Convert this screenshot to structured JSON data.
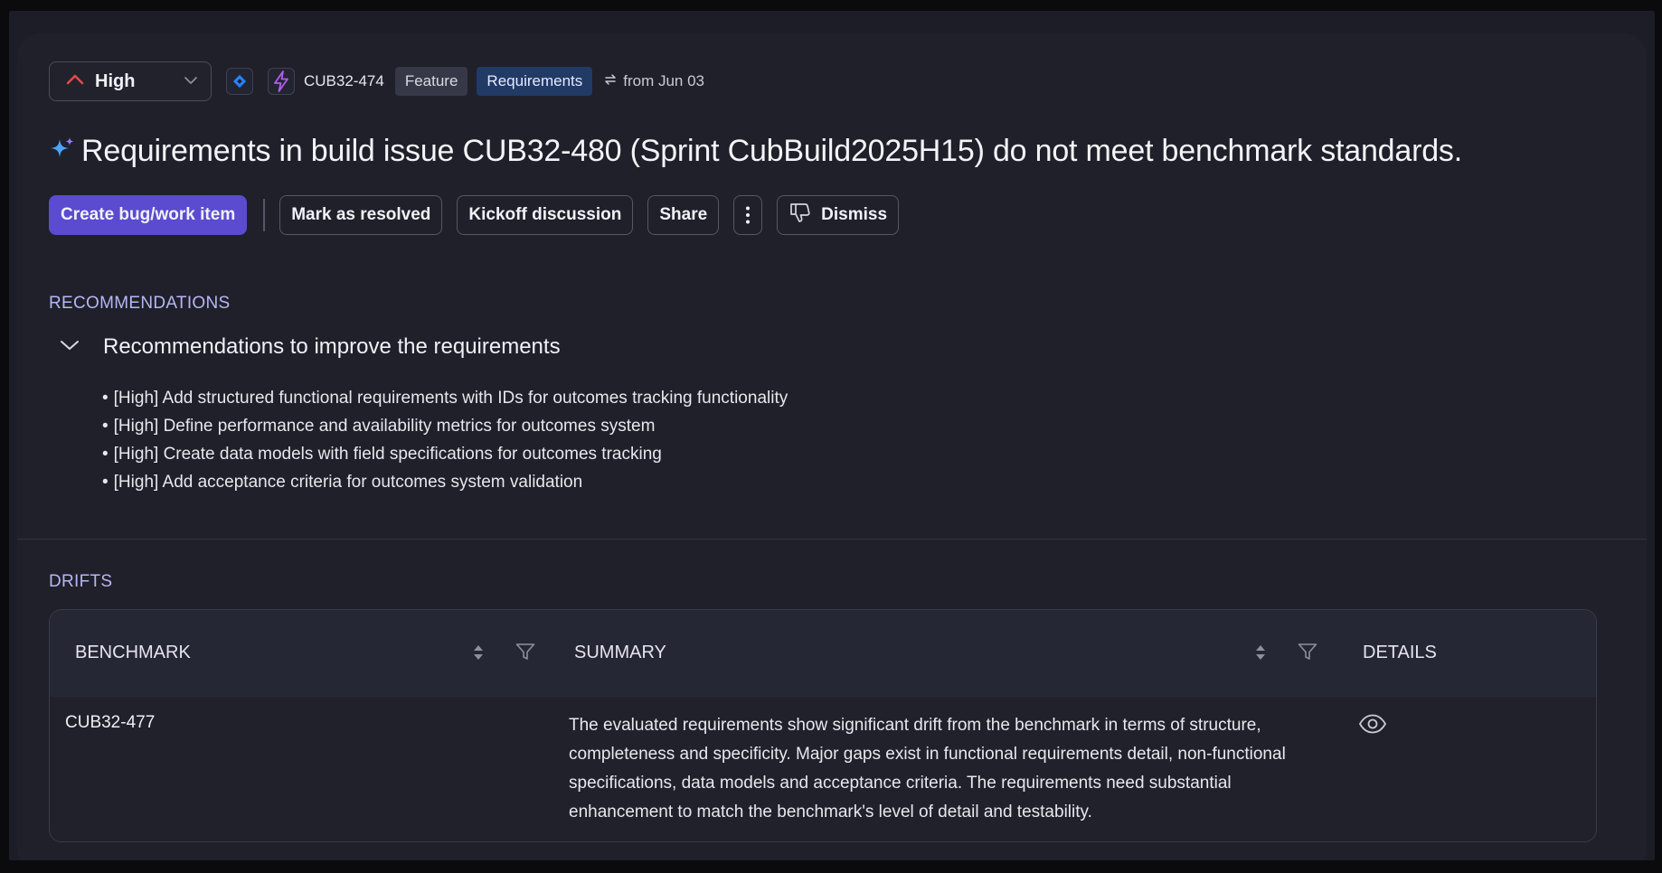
{
  "header": {
    "priority": {
      "label": "High",
      "icon": "priority-high-arrow-icon"
    },
    "tracker_icon": "jira-diamond-icon",
    "issue": {
      "icon": "lightning-bolt-icon",
      "key": "CUB32-474"
    },
    "tags": [
      "Feature",
      "Requirements"
    ],
    "from": {
      "icon": "sync-arrows-icon",
      "text": "from Jun 03"
    }
  },
  "title": {
    "icon": "sparkle-icon",
    "text": "Requirements in build issue CUB32-480 (Sprint CubBuild2025H15) do not meet benchmark standards."
  },
  "actions": {
    "create": "Create bug/work item",
    "resolve": "Mark as resolved",
    "kickoff": "Kickoff discussion",
    "share": "Share",
    "more_icon": "more-vertical-icon",
    "dismiss": "Dismiss",
    "dismiss_icon": "thumbs-down-icon"
  },
  "recommendations": {
    "section_label": "RECOMMENDATIONS",
    "group_title": "Recommendations to improve the requirements",
    "items": [
      "[High] Add structured functional requirements with IDs for outcomes tracking functionality",
      "[High] Define performance and availability metrics for outcomes system",
      "[High] Create data models with field specifications for outcomes tracking",
      "[High] Add acceptance criteria for outcomes system validation"
    ]
  },
  "drifts": {
    "section_label": "DRIFTS",
    "columns": [
      "BENCHMARK",
      "SUMMARY",
      "DETAILS"
    ],
    "rows": [
      {
        "benchmark": "CUB32-477",
        "summary": "The evaluated requirements show significant drift from the benchmark in terms of structure, completeness and specificity. Major gaps exist in functional requirements detail, non-functional specifications, data models and acceptance criteria. The requirements need substantial enhancement to match the benchmark's level of detail and testability.",
        "details_icon": "eye-icon"
      }
    ]
  },
  "colors": {
    "primary": "#5b4bd0",
    "priority_high": "#e5484d",
    "section_label": "#b7b6f6",
    "tag_requirements_bg": "#213a66"
  }
}
